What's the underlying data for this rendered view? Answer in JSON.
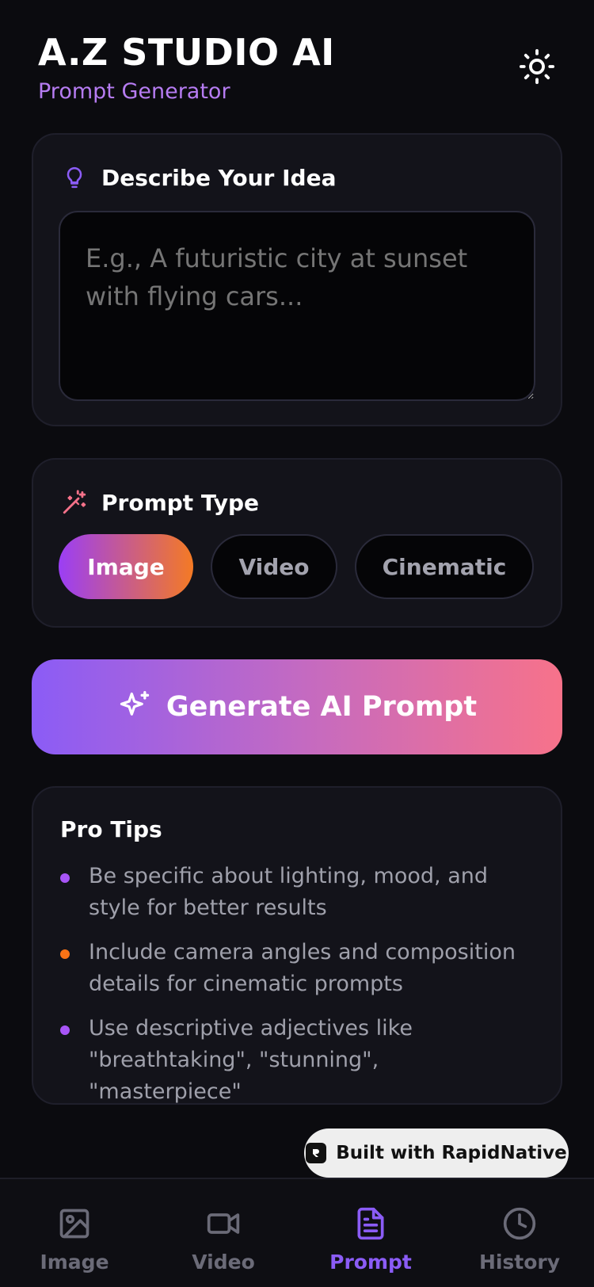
{
  "header": {
    "title": "A.Z STUDIO AI",
    "subtitle": "Prompt Generator"
  },
  "idea_card": {
    "title": "Describe Your Idea",
    "placeholder": "E.g., A futuristic city at sunset with flying cars...",
    "value": ""
  },
  "type_card": {
    "title": "Prompt Type",
    "options": [
      {
        "label": "Image",
        "selected": true
      },
      {
        "label": "Video",
        "selected": false
      },
      {
        "label": "Cinematic",
        "selected": false
      }
    ]
  },
  "generate_button": {
    "label": "Generate AI Prompt"
  },
  "tips": {
    "title": "Pro Tips",
    "items": [
      {
        "text": "Be specific about lighting, mood, and style for better results",
        "color": "#a855f7"
      },
      {
        "text": "Include camera angles and composition details for cinematic prompts",
        "color": "#f97316"
      },
      {
        "text": "Use descriptive adjectives like \"breathtaking\", \"stunning\", \"masterpiece\"",
        "color": "#a855f7"
      }
    ]
  },
  "badge": {
    "label": "Built with RapidNative"
  },
  "bottom_nav": {
    "items": [
      {
        "label": "Image",
        "icon": "image-icon",
        "active": false
      },
      {
        "label": "Video",
        "icon": "video-icon",
        "active": false
      },
      {
        "label": "Prompt",
        "icon": "document-icon",
        "active": true
      },
      {
        "label": "History",
        "icon": "clock-icon",
        "active": false
      }
    ]
  },
  "colors": {
    "background": "#0b0b0f",
    "accent": "#8b5cf6",
    "subtitle": "#b67cf2"
  }
}
